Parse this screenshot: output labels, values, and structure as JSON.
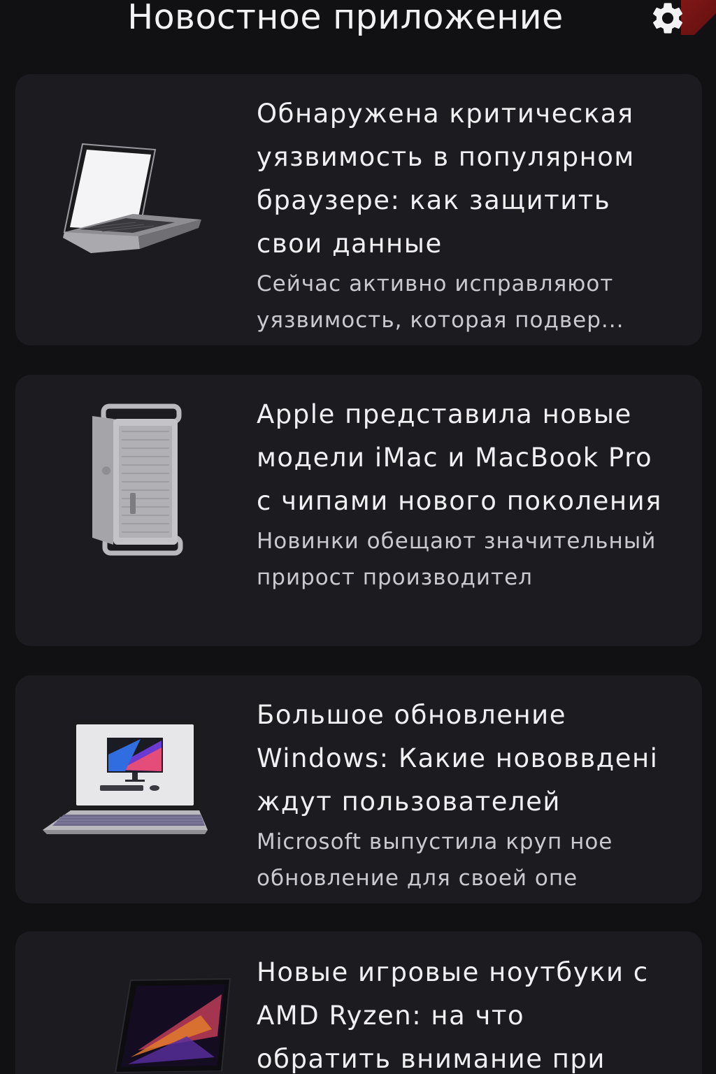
{
  "header": {
    "title": "Новостное приложение",
    "settings_icon": "gear-icon"
  },
  "colors": {
    "background": "#111114",
    "card": "#1c1c20",
    "headline": "#f0f0f3",
    "summary": "#c9c9cf",
    "accent": "#8f1a1a"
  },
  "articles": [
    {
      "title": "Обнаружена критическая уязвимость в популярном браузере: как защитить свои данные",
      "summary": "Сейчас активно исправляюот уязвимость, которая подвер...",
      "image": "laptop-silver-icon"
    },
    {
      "title": "Apple представила новые модели iMac и MacBook Pro с чипами нового поколения",
      "summary": "Новинки обещают значительный прирост производител",
      "image": "tower-computer-icon"
    },
    {
      "title": "Большое обновление Windows: Какие нововвдені ждут пользователей",
      "summary": "Microsoft выпустила круп ное обновление для своей опе",
      "image": "laptop-with-desktop-icon"
    },
    {
      "title": "Новые игровые ноутбуки с AMD Ryzen: на что обратить внимание при",
      "summary": "",
      "image": "gaming-laptop-icon"
    }
  ]
}
